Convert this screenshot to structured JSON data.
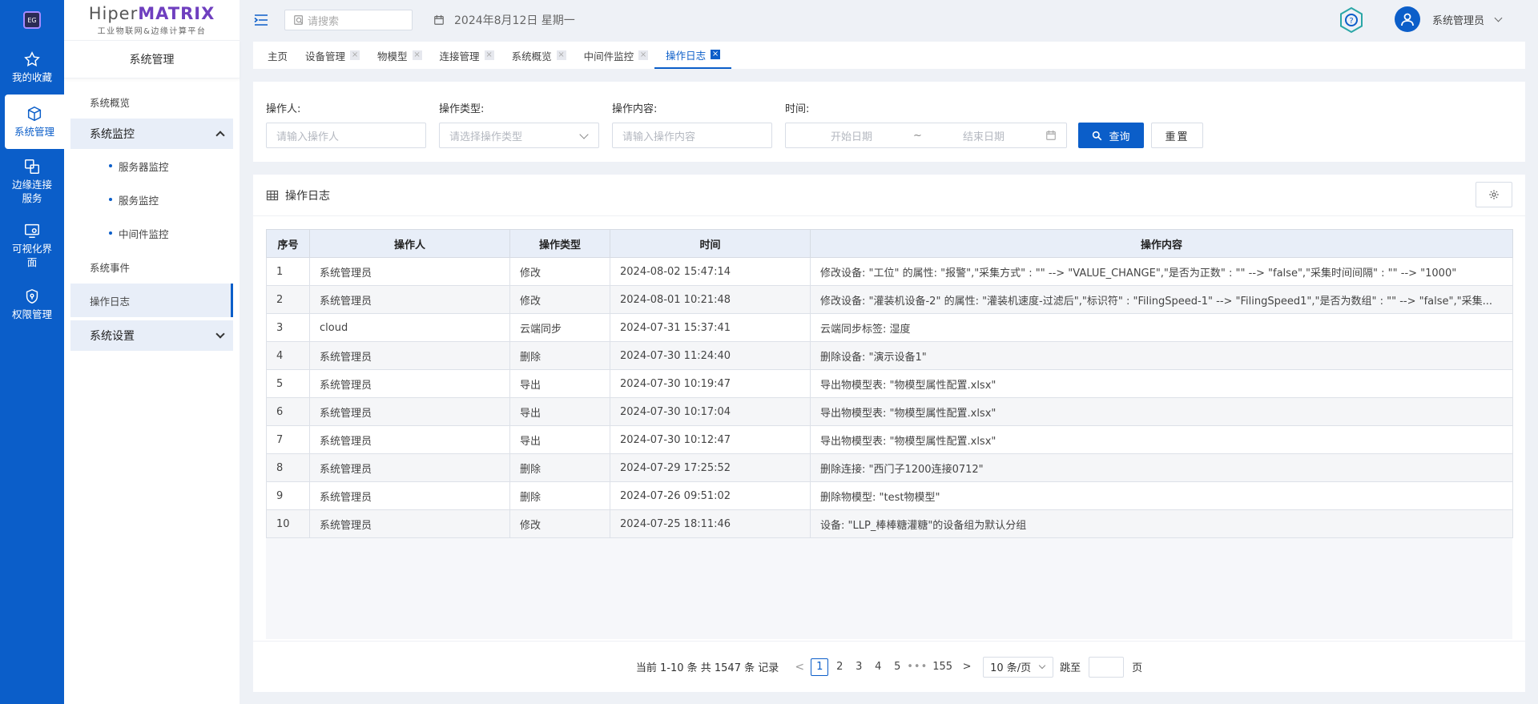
{
  "rail": {
    "items": [
      {
        "label": "我的收藏",
        "icon": "star-icon"
      },
      {
        "label": "系统管理",
        "icon": "cube-icon",
        "active": true
      },
      {
        "label": "边缘连接服务",
        "icon": "link-icon"
      },
      {
        "label": "可视化界面",
        "icon": "screen-eye-icon"
      },
      {
        "label": "权限管理",
        "icon": "shield-icon"
      }
    ]
  },
  "brand": {
    "name_prefix": "Hiper",
    "name_bold": "MATRIX",
    "subtitle": "工业物联网&边缘计算平台"
  },
  "sidebar": {
    "title": "系统管理",
    "overview": "系统概览",
    "monitor_group": "系统监控",
    "monitor_items": [
      "服务器监控",
      "服务监控",
      "中间件监控"
    ],
    "events": "系统事件",
    "oplog": "操作日志",
    "settings_group": "系统设置"
  },
  "header": {
    "search_placeholder": "请搜索",
    "date_text": "2024年8月12日 星期一",
    "user_name": "系统管理员"
  },
  "tabs": [
    {
      "label": "主页",
      "closable": false
    },
    {
      "label": "设备管理",
      "closable": true
    },
    {
      "label": "物模型",
      "closable": true
    },
    {
      "label": "连接管理",
      "closable": true
    },
    {
      "label": "系统概览",
      "closable": true
    },
    {
      "label": "中间件监控",
      "closable": true
    },
    {
      "label": "操作日志",
      "closable": true,
      "active": true
    }
  ],
  "filter": {
    "operator_label": "操作人:",
    "operator_placeholder": "请输入操作人",
    "type_label": "操作类型:",
    "type_placeholder": "请选择操作类型",
    "content_label": "操作内容:",
    "content_placeholder": "请输入操作内容",
    "time_label": "时间:",
    "start_placeholder": "开始日期",
    "range_sep": "~",
    "end_placeholder": "结束日期",
    "query_button": "查询",
    "reset_button": "重置"
  },
  "panel": {
    "title": "操作日志",
    "columns": [
      "序号",
      "操作人",
      "操作类型",
      "时间",
      "操作内容"
    ],
    "rows": [
      [
        "1",
        "系统管理员",
        "修改",
        "2024-08-02 15:47:14",
        "修改设备: \"工位\" 的属性: \"报警\",\"采集方式\" : \"\" --> \"VALUE_CHANGE\",\"是否为正数\" : \"\" --> \"false\",\"采集时间间隔\" : \"\" --> \"1000\""
      ],
      [
        "2",
        "系统管理员",
        "修改",
        "2024-08-01 10:21:48",
        "修改设备: \"灌装机设备-2\" 的属性: \"灌装机速度-过滤后\",\"标识符\" : \"FilingSpeed-1\" --> \"FilingSpeed1\",\"是否为数组\" : \"\" --> \"false\",\"采集..."
      ],
      [
        "3",
        "cloud",
        "云端同步",
        "2024-07-31 15:37:41",
        "云端同步标签: 湿度"
      ],
      [
        "4",
        "系统管理员",
        "删除",
        "2024-07-30 11:24:40",
        "删除设备: \"演示设备1\""
      ],
      [
        "5",
        "系统管理员",
        "导出",
        "2024-07-30 10:19:47",
        "导出物模型表: \"物模型属性配置.xlsx\""
      ],
      [
        "6",
        "系统管理员",
        "导出",
        "2024-07-30 10:17:04",
        "导出物模型表: \"物模型属性配置.xlsx\""
      ],
      [
        "7",
        "系统管理员",
        "导出",
        "2024-07-30 10:12:47",
        "导出物模型表: \"物模型属性配置.xlsx\""
      ],
      [
        "8",
        "系统管理员",
        "删除",
        "2024-07-29 17:25:52",
        "删除连接: \"西门子1200连接0712\""
      ],
      [
        "9",
        "系统管理员",
        "删除",
        "2024-07-26 09:51:02",
        "删除物模型: \"test物模型\""
      ],
      [
        "10",
        "系统管理员",
        "修改",
        "2024-07-25 18:11:46",
        "设备: \"LLP_棒棒糖灌糖\"的设备组为默认分组"
      ]
    ]
  },
  "pager": {
    "total_text": "当前 1-10 条 共 1547 条 记录",
    "prev": "<",
    "pages": [
      "1",
      "2",
      "3",
      "4",
      "5"
    ],
    "ellipsis": "•••",
    "last_page": "155",
    "next": ">",
    "page_size": "10 条/页",
    "jump_label": "跳至",
    "jump_unit": "页"
  },
  "colors": {
    "accent": "#0b5ec9",
    "brand_purple": "#6f3fbf",
    "header_row": "#e8eef8",
    "bg": "#eef1f6"
  }
}
